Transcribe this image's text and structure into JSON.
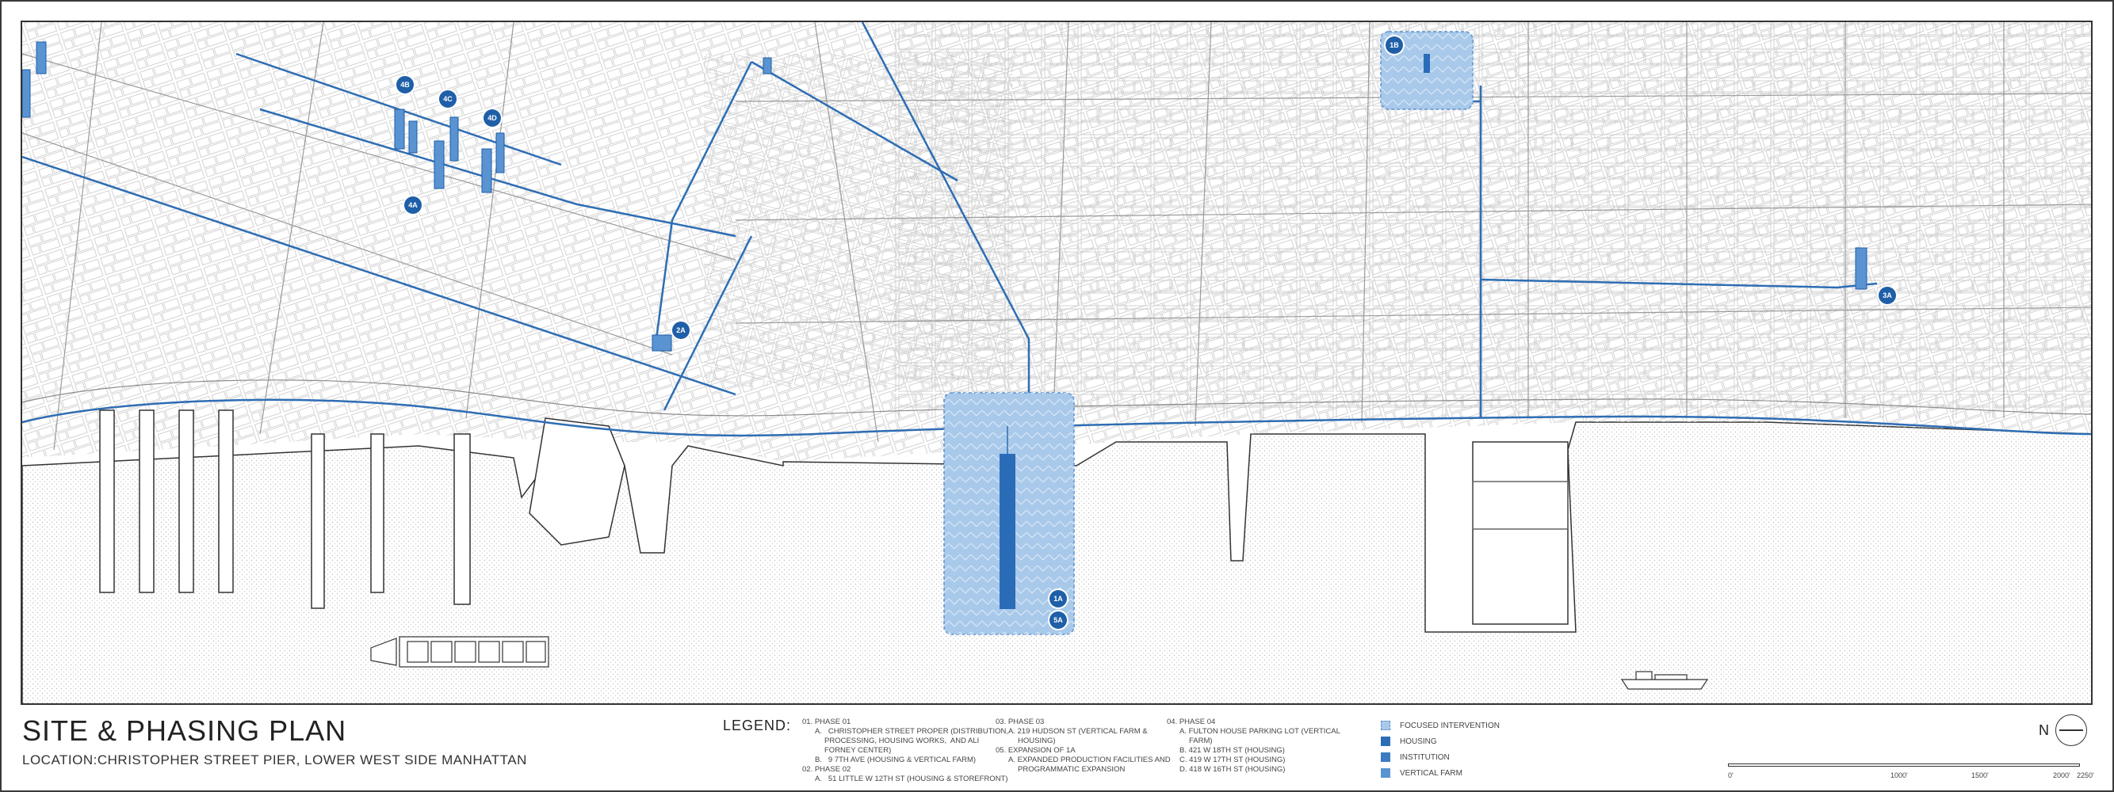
{
  "title": "SITE & PHASING PLAN",
  "location": "LOCATION:CHRISTOPHER STREET PIER, LOWER WEST SIDE MANHATTAN",
  "legend": {
    "heading": "LEGEND:",
    "col1": [
      "01. PHASE 01",
      "A.   CHRISTOPHER STREET PROPER (DISTRIBUTION,",
      "PROCESSING, HOUSING WORKS,  AND ALI",
      "FORNEY CENTER)",
      "B.   9 7TH AVE (HOUSING & VERTICAL FARM)",
      "02. PHASE 02",
      "A.   51 LITTLE W 12TH ST (HOUSING & STOREFRONT)"
    ],
    "col2": [
      "03. PHASE 03",
      "A. 219 HUDSON ST (VERTICAL FARM &",
      "HOUSING)",
      "05. EXPANSION OF 1A",
      "A. EXPANDED PRODUCTION FACILITIES AND",
      "PROGRAMMATIC EXPANSION"
    ],
    "col3": [
      "04. PHASE 04",
      "A. FULTON HOUSE PARKING LOT (VERTICAL",
      "FARM)",
      "B. 421 W 18TH ST (HOUSING)",
      "C. 419 W 17TH ST (HOUSING)",
      "D. 418 W 16TH ST (HOUSING)"
    ],
    "key": [
      {
        "label": "FOCUSED INTERVENTION",
        "color": "#a9c9ea"
      },
      {
        "label": "HOUSING",
        "color": "#2a6cb8"
      },
      {
        "label": "INSTITUTION",
        "color": "#3d7cc2"
      },
      {
        "label": "VERTICAL FARM",
        "color": "#5a93d1"
      }
    ]
  },
  "markers": [
    "4B",
    "4C",
    "4D",
    "4A",
    "2A",
    "1B",
    "3A",
    "1A",
    "5A"
  ],
  "north": "N",
  "scale": [
    "0'",
    "1000'",
    "1500'",
    "2000'",
    "2250'"
  ],
  "colors": {
    "accent": "#1f5fa8",
    "route": "#2e6db4",
    "water_dot": "#bdbdbd",
    "street": "#b5b5b5"
  }
}
